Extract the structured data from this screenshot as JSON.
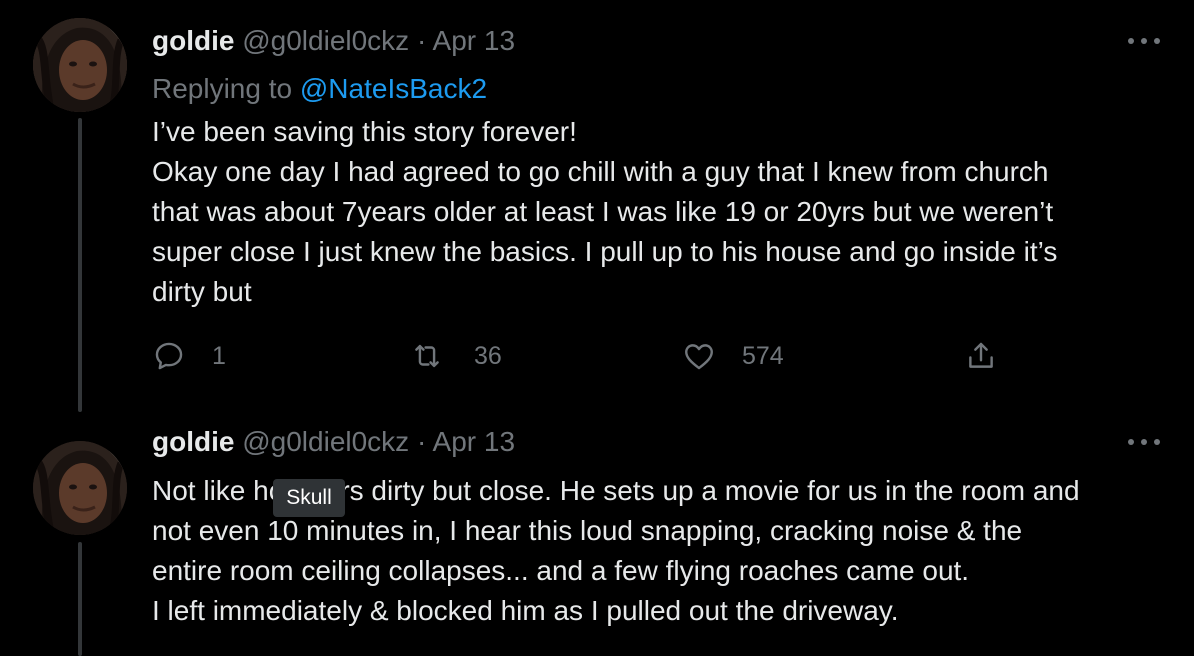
{
  "tweets": [
    {
      "author_name": "goldie",
      "handle": "@g0ldiel0ckz",
      "separator": "·",
      "date": "Apr 13",
      "replying_prefix": "Replying to",
      "replying_to": "@NateIsBack2",
      "body_lines": [
        "I’ve been saving this story forever!",
        "Okay one day I had agreed to go chill with a guy that I knew from church",
        "that was about 7years older at least I was like 19 or 20yrs but we weren’t",
        "super close I just knew the basics. I pull up to his house and go inside it’s",
        "dirty but"
      ],
      "reply_count": "1",
      "retweet_count": "36",
      "like_count": "574"
    },
    {
      "author_name": "goldie",
      "handle": "@g0ldiel0ckz",
      "separator": "·",
      "date": "Apr 13",
      "body_lines": [
        "Not like hoarders dirty but close. He sets up a movie for us in the room and",
        "not even 10 minutes in, I hear this loud snapping, cracking noise & the",
        "entire room ceiling collapses... and a few flying roaches came out.",
        "I left immediately & blocked him as I pulled out the driveway."
      ]
    }
  ],
  "tooltip": "Skull",
  "icons": {
    "reply": "reply-icon",
    "retweet": "retweet-icon",
    "like": "heart-icon",
    "share": "share-icon",
    "more": "more-icon"
  },
  "colors": {
    "background": "#000000",
    "text": "#e7e9ea",
    "muted": "#71767b",
    "link": "#1d9bf0"
  }
}
